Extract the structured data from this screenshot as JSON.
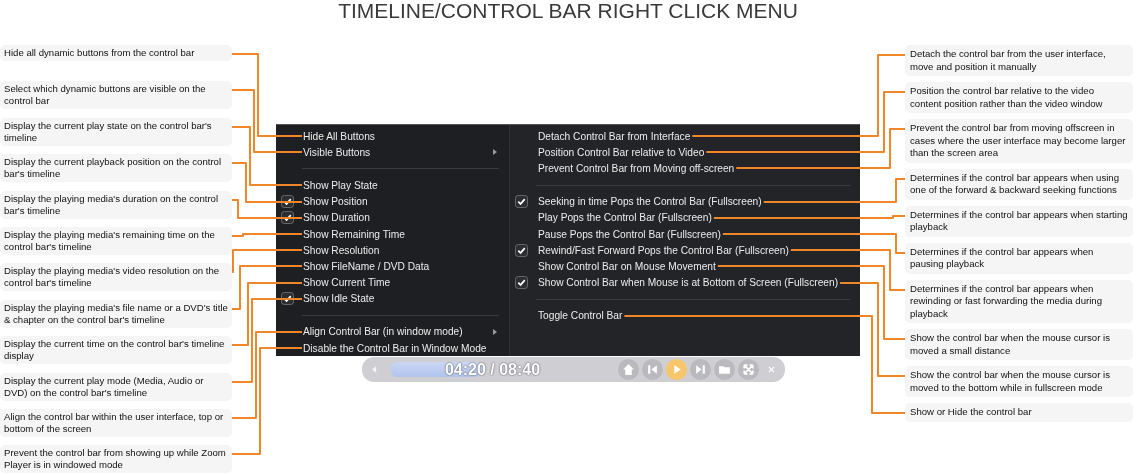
{
  "title": "TIMELINE/CONTROL BAR RIGHT CLICK MENU",
  "left_notes": [
    "Hide all dynamic buttons from the control bar",
    "Select which dynamic buttons are visible on the control bar",
    "Display the current play state on the control bar's timeline",
    "Display the current playback position on the control bar's timeline",
    "Display the playing media's duration on the control bar's timeline",
    "Display the playing media's remaining time on the control bar's timeline",
    "Display the playing media's video resolution on the control bar's timeline",
    "Display the playing media's file name or a DVD's title & chapter on the control bar's timeline",
    "Display the current time on the control bar's timeline display",
    "Display the current play mode (Media, Audio or DVD) on the control bar's timeline",
    "Align the control bar within the user interface, top or bottom of the screen",
    "Prevent the control bar from showing up while Zoom Player is in windowed mode"
  ],
  "menu": {
    "left": [
      {
        "kind": "item",
        "label": "Hide All Buttons",
        "checked": false,
        "submenu": false
      },
      {
        "kind": "item",
        "label": "Visible Buttons",
        "checked": false,
        "submenu": true
      },
      {
        "kind": "separator"
      },
      {
        "kind": "item",
        "label": "Show Play State",
        "checked": false,
        "submenu": false
      },
      {
        "kind": "item",
        "label": "Show Position",
        "checked": true,
        "submenu": false
      },
      {
        "kind": "item",
        "label": "Show Duration",
        "checked": true,
        "submenu": false
      },
      {
        "kind": "item",
        "label": "Show Remaining Time",
        "checked": false,
        "submenu": false
      },
      {
        "kind": "item",
        "label": "Show Resolution",
        "checked": false,
        "submenu": false
      },
      {
        "kind": "item",
        "label": "Show FileName / DVD Data",
        "checked": false,
        "submenu": false
      },
      {
        "kind": "item",
        "label": "Show Current Time",
        "checked": false,
        "submenu": false
      },
      {
        "kind": "item",
        "label": "Show Idle State",
        "checked": true,
        "submenu": false
      },
      {
        "kind": "separator"
      },
      {
        "kind": "item",
        "label": "Align Control Bar (in window mode)",
        "checked": false,
        "submenu": true
      },
      {
        "kind": "item",
        "label": "Disable the Control Bar in Window Mode",
        "checked": false,
        "submenu": false
      }
    ],
    "right": [
      {
        "kind": "item",
        "label": "Detach Control Bar from Interface",
        "checked": false,
        "submenu": false
      },
      {
        "kind": "item",
        "label": "Position Control Bar relative to Video",
        "checked": false,
        "submenu": false
      },
      {
        "kind": "item",
        "label": "Prevent Control Bar from Moving off-screen",
        "checked": false,
        "submenu": false
      },
      {
        "kind": "separator"
      },
      {
        "kind": "item",
        "label": "Seeking in time Pops the Control Bar (Fullscreen)",
        "checked": true,
        "submenu": false
      },
      {
        "kind": "item",
        "label": "Play Pops the Control Bar (Fullscreen)",
        "checked": false,
        "submenu": false
      },
      {
        "kind": "item",
        "label": "Pause Pops the Control Bar (Fullscreen)",
        "checked": false,
        "submenu": false
      },
      {
        "kind": "item",
        "label": "Rewind/Fast Forward Pops the Control Bar (Fullscreen)",
        "checked": true,
        "submenu": false
      },
      {
        "kind": "item",
        "label": "Show Control Bar on Mouse Movement",
        "checked": false,
        "submenu": false
      },
      {
        "kind": "item",
        "label": "Show Control Bar when Mouse is at Bottom of Screen (Fullscreen)",
        "checked": true,
        "submenu": false
      },
      {
        "kind": "separator"
      },
      {
        "kind": "item",
        "label": "Toggle Control Bar",
        "checked": false,
        "submenu": false
      }
    ]
  },
  "right_notes": [
    "Detach the control bar from the user interface, move and position it manually",
    "Position the control bar relative to the video content position rather than the video window",
    "Prevent the control bar from moving offscreen in cases where the user interface may become larger than the screen area",
    "Determines if the control bar appears when using one of the forward & backward seeking functions",
    "Determines if the control bar appears when starting playback",
    "Determines if the control bar appears when pausing playback",
    "Determines if the control bar appears when rewinding or fast forwarding the media during playback",
    "Show the control bar when the mouse cursor is moved a small distance",
    "Show the control bar when the mouse cursor is moved to the bottom while in fullscreen mode",
    "Show or Hide the control bar"
  ],
  "control_bar": {
    "time": "04:20 / 08:40",
    "level": 0.45
  }
}
